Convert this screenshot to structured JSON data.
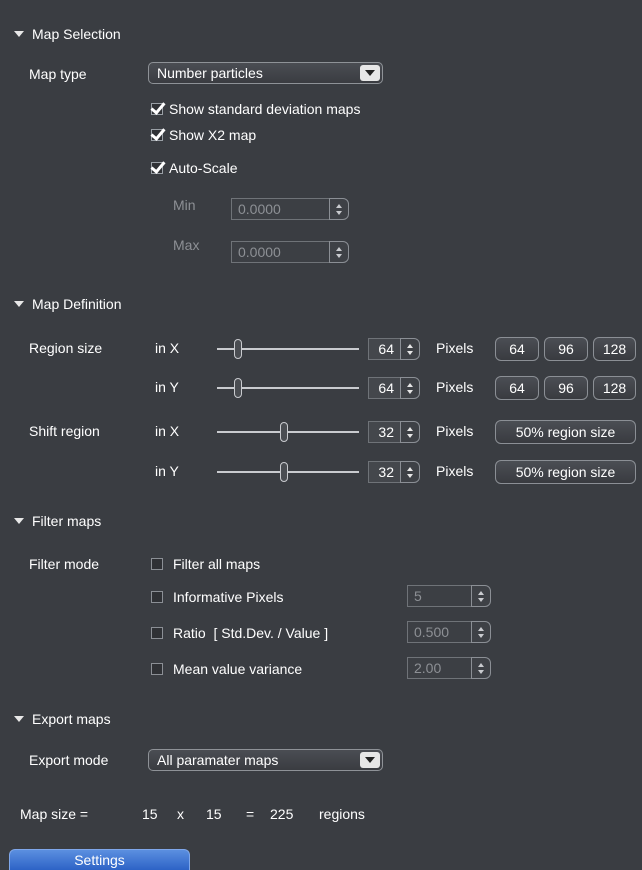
{
  "map_selection": {
    "header": "Map Selection",
    "map_type_label": "Map type",
    "map_type_value": "Number particles",
    "show_std_dev": {
      "label": "Show standard deviation maps",
      "checked": true
    },
    "show_x2": {
      "label": "Show X2 map",
      "checked": true
    },
    "auto_scale": {
      "label": "Auto-Scale",
      "checked": true
    },
    "min": {
      "label": "Min",
      "value": "0.0000"
    },
    "max": {
      "label": "Max",
      "value": "0.0000"
    }
  },
  "map_definition": {
    "header": "Map Definition",
    "region_size_label": "Region size",
    "shift_region_label": "Shift region",
    "in_x": "in X",
    "in_y": "in Y",
    "pixels": "Pixels",
    "region_x": {
      "value": "64",
      "slider_fraction": 0.13
    },
    "region_y": {
      "value": "64",
      "slider_fraction": 0.13
    },
    "shift_x": {
      "value": "32",
      "slider_fraction": 0.47
    },
    "shift_y": {
      "value": "32",
      "slider_fraction": 0.47
    },
    "presets": [
      "64",
      "96",
      "128"
    ],
    "half_region": "50% region size"
  },
  "filter_maps": {
    "header": "Filter maps",
    "mode_label": "Filter mode",
    "filter_all": {
      "label": "Filter all maps",
      "checked": false
    },
    "informative": {
      "label": "Informative Pixels",
      "checked": false,
      "value": "5"
    },
    "ratio": {
      "label": "Ratio  [ Std.Dev. / Value ]",
      "checked": false,
      "value": "0.500"
    },
    "mean_var": {
      "label": "Mean value variance",
      "checked": false,
      "value": "2.00"
    }
  },
  "export_maps": {
    "header": "Export maps",
    "mode_label": "Export mode",
    "mode_value": "All paramater maps"
  },
  "map_size": {
    "label": "Map size =",
    "x": "15",
    "times": "x",
    "y": "15",
    "equals": "=",
    "total": "225",
    "unit": "regions"
  },
  "settings_tab": "Settings"
}
